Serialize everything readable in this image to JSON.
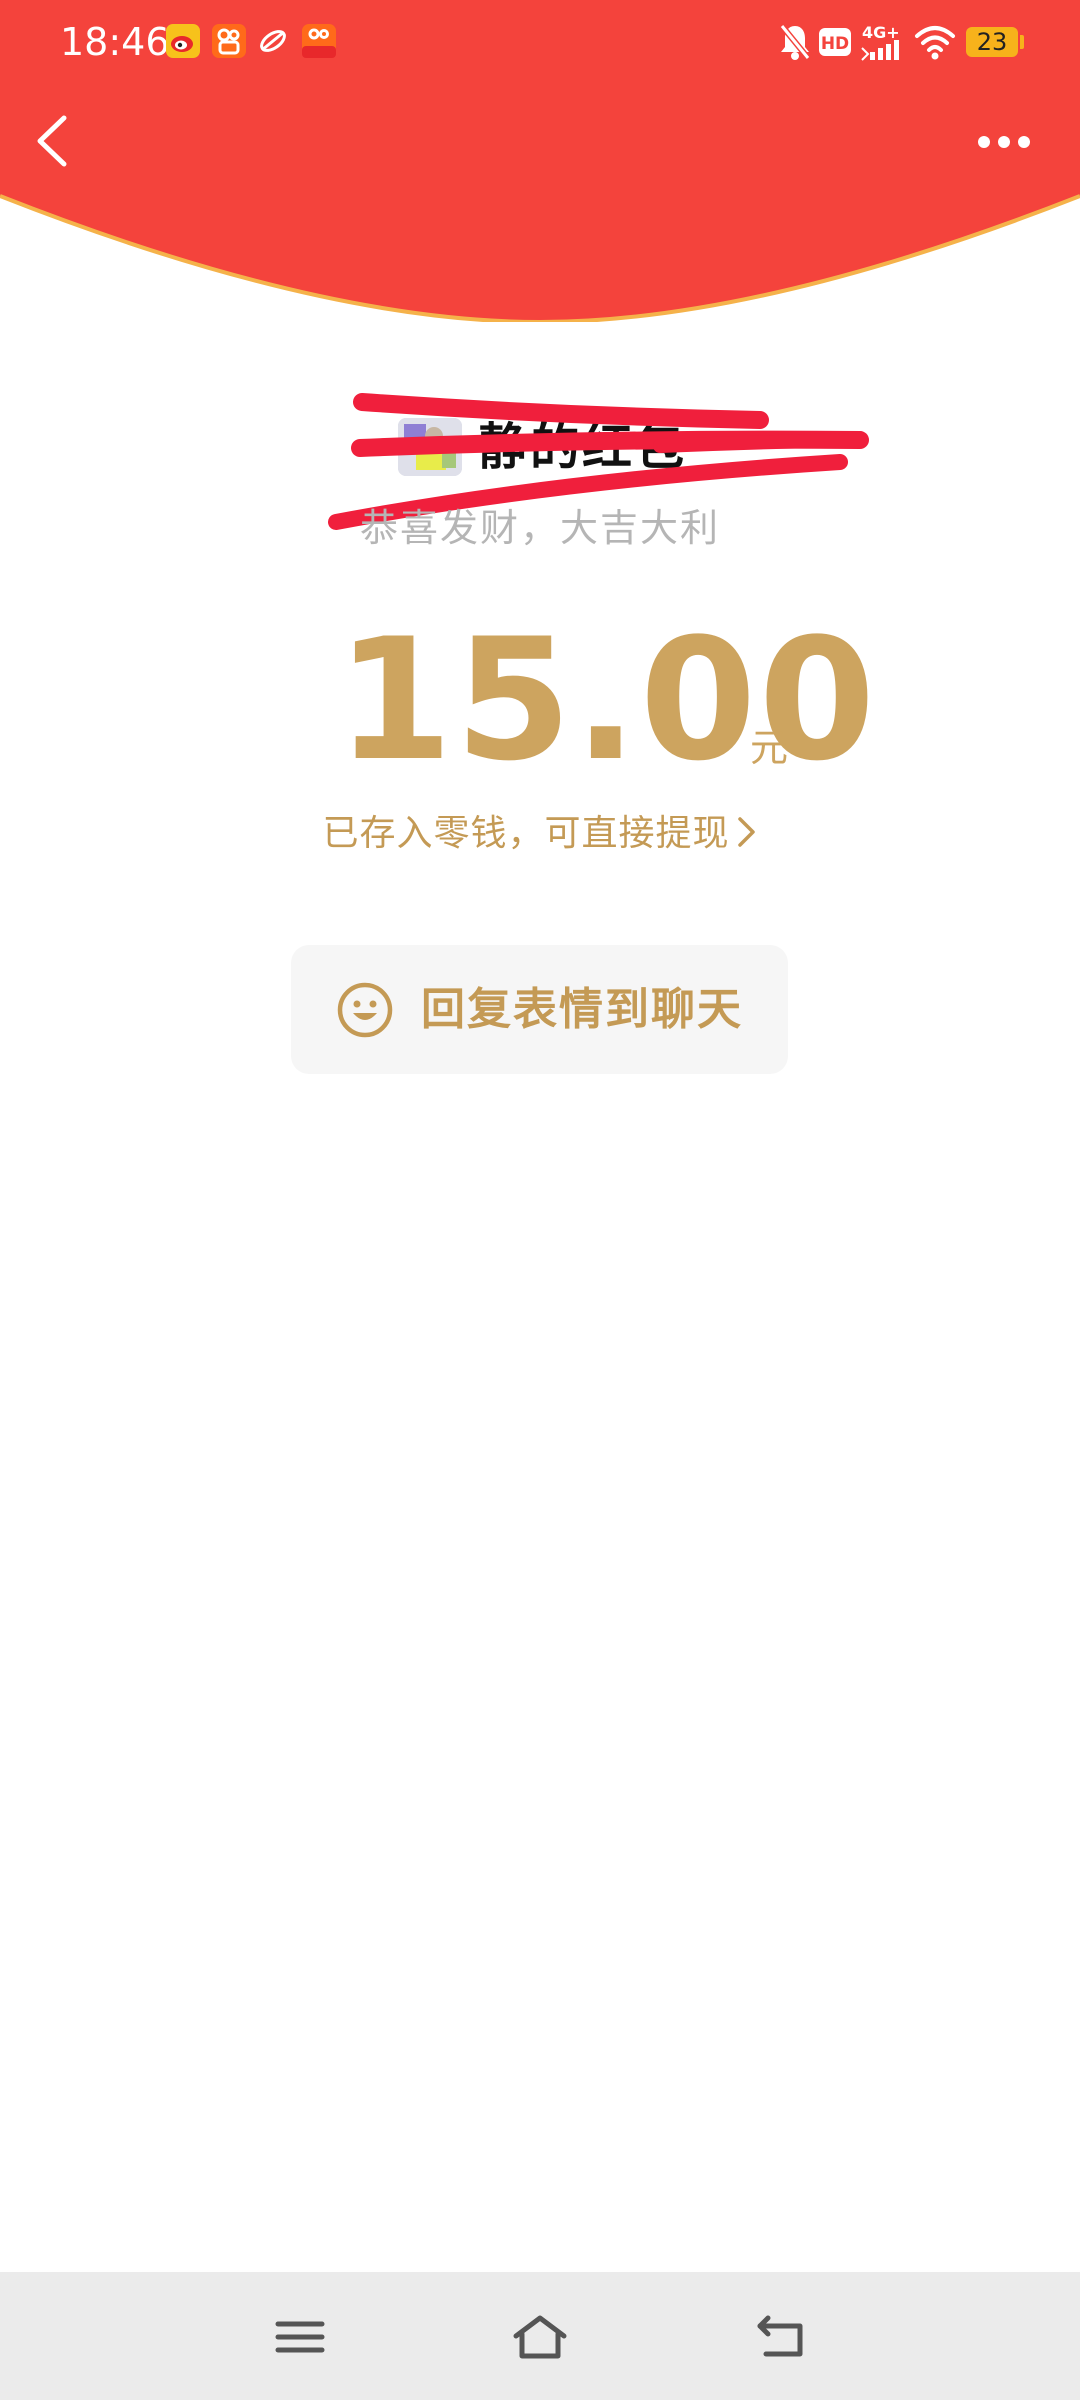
{
  "status_bar": {
    "time": "18:46",
    "notification_icons": [
      "weibo-icon",
      "kuaishou-icon",
      "app-swirl-icon",
      "kuaishou-lite-icon"
    ],
    "system_icons": [
      "mute-bell-icon",
      "hd-icon",
      "4g-signal-icon",
      "wifi-icon"
    ],
    "battery_level": "23"
  },
  "header": {
    "background_color": "#f4433c",
    "border_color": "#f5b24a"
  },
  "sender": {
    "name": "静的红包",
    "blessing": "恭喜发财，大吉大利"
  },
  "amount": {
    "value": "15.00",
    "unit": "元",
    "color": "#cda45f"
  },
  "deposit": {
    "text": "已存入零钱，可直接提现"
  },
  "reply": {
    "label": "回复表情到聊天"
  },
  "nav_bar": {
    "buttons": [
      "menu-icon",
      "home-icon",
      "back-arrow-icon"
    ]
  }
}
